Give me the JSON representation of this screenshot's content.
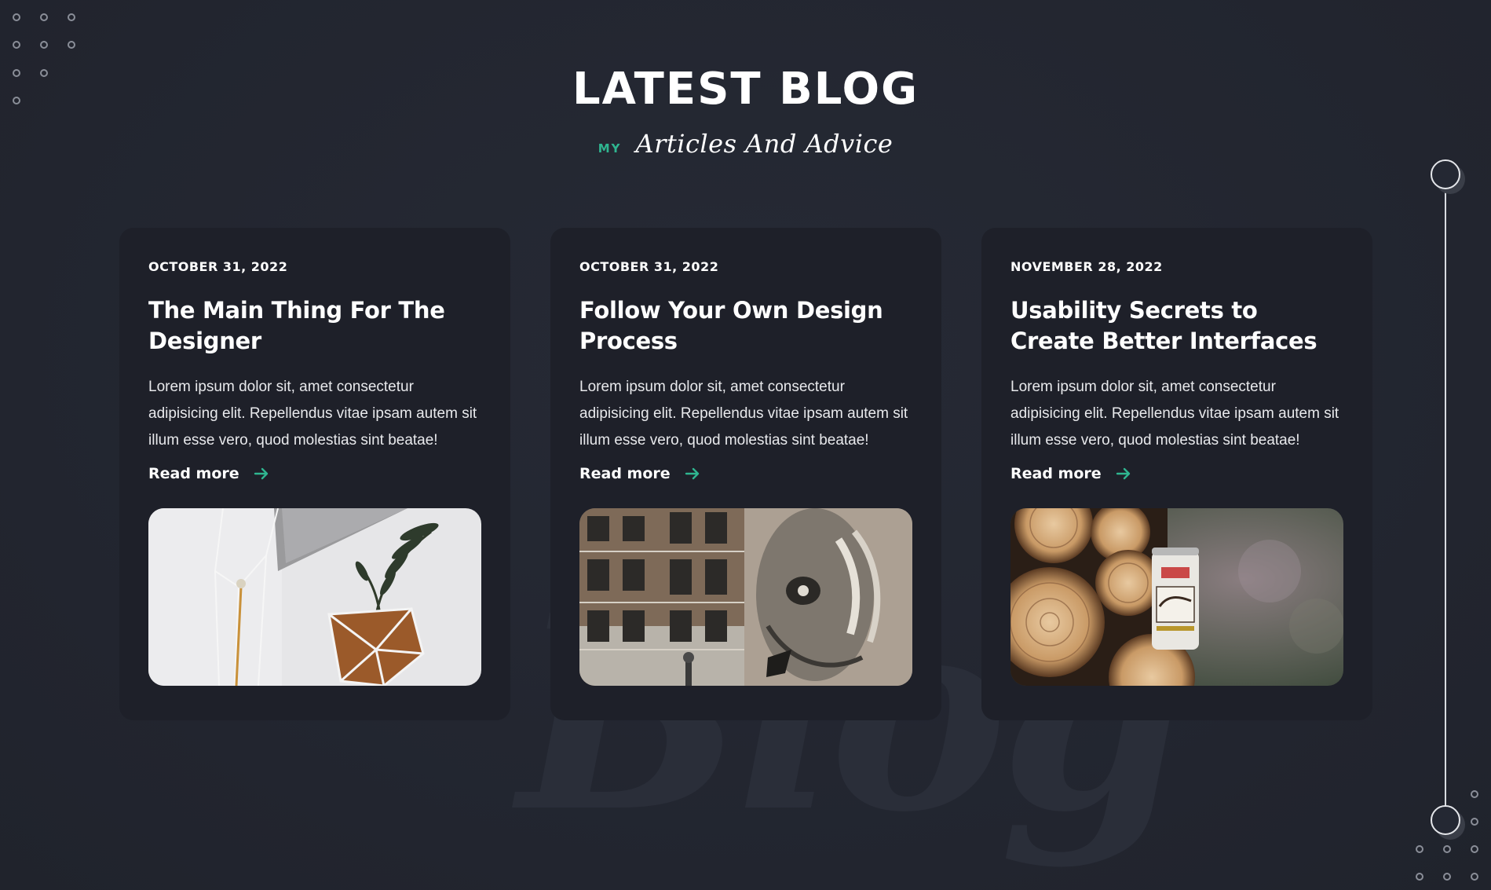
{
  "section": {
    "title": "LATEST BLOG",
    "subtitle_prefix": "MY",
    "subtitle_script": "Articles And Advice",
    "watermark": "Blog"
  },
  "colors": {
    "background": "#242833",
    "card": "#1e2029",
    "accent": "#2fb590",
    "text": "#ffffff"
  },
  "posts": [
    {
      "date": "OCTOBER 31, 2022",
      "title": "The Main Thing For The Designer",
      "excerpt": "Lorem ipsum dolor sit, amet consectetur adipisicing elit. Repellendus vitae ipsam autem sit illum esse vero, quod molestias sint beatae!",
      "read_more": "Read more",
      "image": "plant-in-geometric-pot-photo"
    },
    {
      "date": "OCTOBER 31, 2022",
      "title": "Follow Your Own Design Process",
      "excerpt": "Lorem ipsum dolor sit, amet consectetur adipisicing elit. Repellendus vitae ipsam autem sit illum esse vero, quod molestias sint beatae!",
      "read_more": "Read more",
      "image": "building-with-mural-photo"
    },
    {
      "date": "NOVEMBER 28, 2022",
      "title": "Usability Secrets to Create Better Interfaces",
      "excerpt": "Lorem ipsum dolor sit, amet consectetur adipisicing elit. Repellendus vitae ipsam autem sit illum esse vero, quod molestias sint beatae!",
      "read_more": "Read more",
      "image": "logs-and-can-photo"
    }
  ],
  "icons": {
    "read_more": "arrow-right-icon"
  }
}
